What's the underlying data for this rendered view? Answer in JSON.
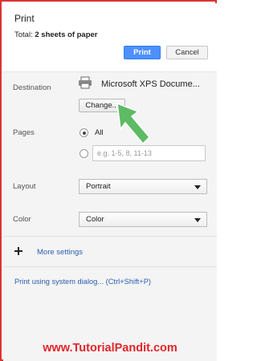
{
  "header": {
    "title": "Print",
    "total_label": "Total:",
    "total_value": "2 sheets of paper",
    "print_button": "Print",
    "cancel_button": "Cancel"
  },
  "destination": {
    "label": "Destination",
    "printer_name": "Microsoft XPS Docume...",
    "change_button": "Change..."
  },
  "pages": {
    "label": "Pages",
    "all_label": "All",
    "selected": "All",
    "custom_placeholder": "e.g. 1-5, 8, 11-13"
  },
  "layout": {
    "label": "Layout",
    "value": "Portrait"
  },
  "color": {
    "label": "Color",
    "value": "Color"
  },
  "more_settings": {
    "label": "More settings",
    "icon": "plus-icon"
  },
  "system_dialog": {
    "label": "Print using system dialog... (Ctrl+Shift+P)"
  },
  "watermark": {
    "text": "www.TutorialPandit.com"
  },
  "colors": {
    "accent": "#4d90fe",
    "link": "#2a5db0",
    "watermark": "#e0252a",
    "annotation_arrow": "#5dbb63"
  }
}
